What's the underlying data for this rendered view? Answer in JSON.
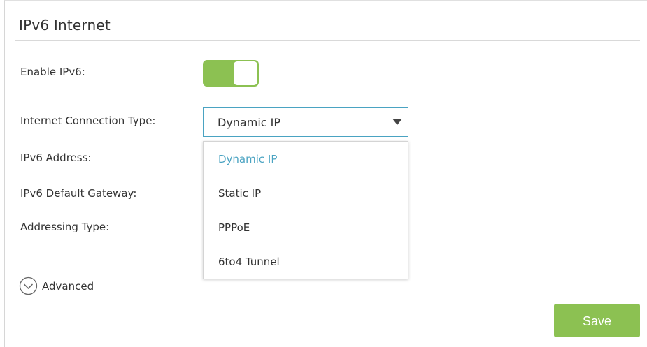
{
  "page": {
    "title": "IPv6 Internet"
  },
  "fields": {
    "enable_label": "Enable IPv6:",
    "connection_type_label": "Internet Connection Type:",
    "address_label": "IPv6 Address:",
    "gateway_label": "IPv6 Default Gateway:",
    "addressing_type_label": "Addressing Type:"
  },
  "enable_toggle": {
    "state": "on",
    "color": "#8cc152"
  },
  "connection_select": {
    "value": "Dynamic IP",
    "accent_color": "#4aa3c2",
    "options": [
      "Dynamic IP",
      "Static IP",
      "PPPoE",
      "6to4 Tunnel"
    ],
    "selected_index": 0
  },
  "advanced": {
    "label": "Advanced",
    "icon": "chevron-down-circle-icon"
  },
  "actions": {
    "save_label": "Save",
    "save_color": "#8cc152"
  }
}
